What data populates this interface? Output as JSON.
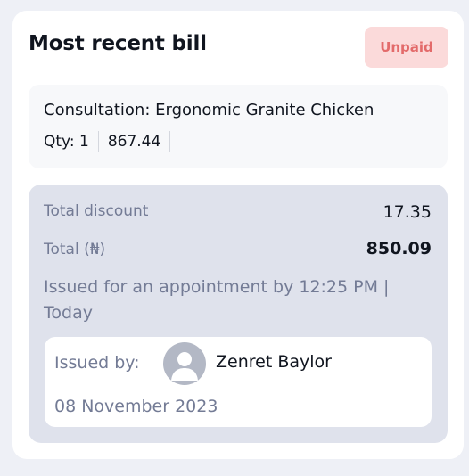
{
  "bill_card": {
    "title": "Most recent bill",
    "status": "Unpaid",
    "status_color": "#e36a6a",
    "item": {
      "name": "Consultation: Ergonomic Granite Chicken",
      "qty_label": "Qty: 1",
      "amount": "867.44"
    },
    "summary": {
      "discount_label": "Total discount",
      "discount_value": "17.35",
      "total_label": "Total (₦)",
      "total_value": "850.09",
      "issued_note": "Issued for an appointment by 12:25 PM | Today"
    },
    "issuer": {
      "label": "Issued by:",
      "avatar_icon": "user-avatar-icon",
      "name": "Zenret Baylor",
      "date": "08 November 2023"
    }
  }
}
